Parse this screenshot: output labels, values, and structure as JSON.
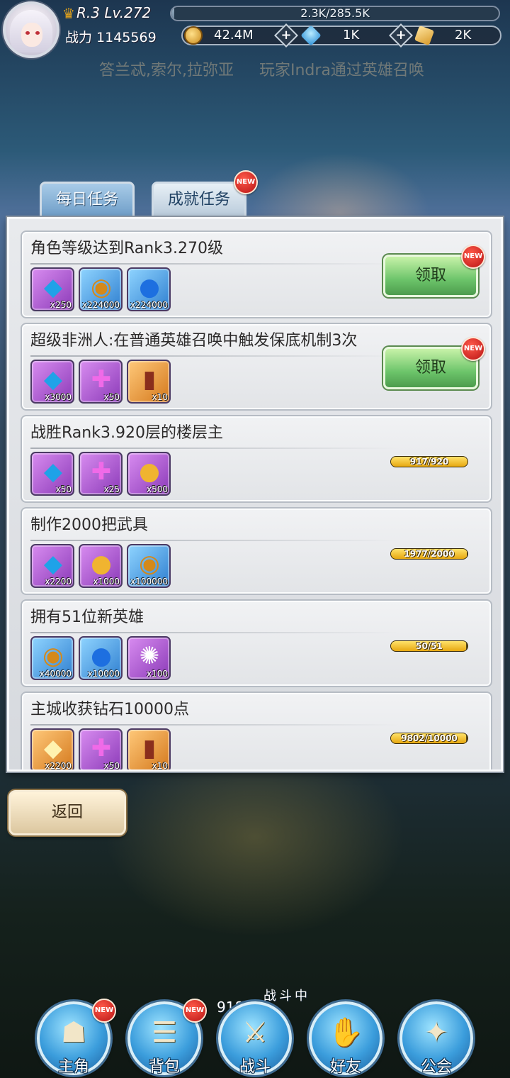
{
  "player": {
    "rank_level": "R.3 Lv.272",
    "exp_text": "2.3K/285.5K",
    "exp_fraction": 0.008,
    "power_label": "战力 1145569"
  },
  "currencies": [
    {
      "icon": "gold-coin-icon",
      "value": "42.4M"
    },
    {
      "icon": "diamond-icon",
      "value": "1K"
    },
    {
      "icon": "crystal-icon",
      "value": "2K"
    }
  ],
  "ticker": [
    "答兰忒,索尔,拉弥亚",
    "玩家Indra通过英雄召唤"
  ],
  "tabs": [
    {
      "label": "每日任务",
      "active": false
    },
    {
      "label": "成就任务",
      "active": true,
      "badge": "NEW"
    }
  ],
  "tasks": [
    {
      "title": "角色等级达到Rank3.270级",
      "rewards": [
        {
          "icon": "diamond-icon",
          "glyph": "◆",
          "bg": "purple",
          "count": "x250"
        },
        {
          "icon": "gold-coin-icon",
          "glyph": "◉",
          "bg": "blue",
          "count": "x224000"
        },
        {
          "icon": "potion-icon",
          "glyph": "●",
          "bg": "blue",
          "count": "x224000"
        }
      ],
      "action": "claim",
      "action_label": "领取",
      "badge": "NEW"
    },
    {
      "title": "超级非洲人:在普通英雄召唤中触发保底机制3次",
      "rewards": [
        {
          "icon": "diamond-icon",
          "glyph": "◆",
          "bg": "purple",
          "count": "x3000"
        },
        {
          "icon": "puzzle-icon",
          "glyph": "✚",
          "bg": "purple",
          "count": "x50"
        },
        {
          "icon": "summon-card-icon",
          "glyph": "▮",
          "bg": "orange",
          "count": "x10"
        }
      ],
      "action": "claim",
      "action_label": "领取",
      "badge": "NEW"
    },
    {
      "title": "战胜Rank3.920层的楼层主",
      "rewards": [
        {
          "icon": "diamond-icon",
          "glyph": "◆",
          "bg": "purple",
          "count": "x50"
        },
        {
          "icon": "puzzle-icon",
          "glyph": "✚",
          "bg": "purple",
          "count": "x25"
        },
        {
          "icon": "treasure-bag-icon",
          "glyph": "●",
          "bg": "purple",
          "count": "x500"
        }
      ],
      "action": "progress",
      "progress_text": "917/920",
      "progress": 0.997
    },
    {
      "title": "制作2000把武具",
      "rewards": [
        {
          "icon": "diamond-icon",
          "glyph": "◆",
          "bg": "purple",
          "count": "x2200"
        },
        {
          "icon": "treasure-bag-icon",
          "glyph": "●",
          "bg": "purple",
          "count": "x1000"
        },
        {
          "icon": "gold-coin-icon",
          "glyph": "◉",
          "bg": "blue",
          "count": "x100000"
        }
      ],
      "action": "progress",
      "progress_text": "1977/2000",
      "progress": 0.989
    },
    {
      "title": "拥有51位新英雄",
      "rewards": [
        {
          "icon": "gold-coin-icon",
          "glyph": "◉",
          "bg": "blue",
          "count": "x40000"
        },
        {
          "icon": "potion-icon",
          "glyph": "●",
          "bg": "blue",
          "count": "x10000"
        },
        {
          "icon": "rainbow-orb-icon",
          "glyph": "✺",
          "bg": "purple",
          "count": "x100"
        }
      ],
      "action": "progress",
      "progress_text": "50/51",
      "progress": 0.98
    },
    {
      "title": "主城收获钻石10000点",
      "rewards": [
        {
          "icon": "crystal-icon",
          "glyph": "◆",
          "bg": "orange",
          "count": "x2200"
        },
        {
          "icon": "puzzle-icon",
          "glyph": "✚",
          "bg": "purple",
          "count": "x50"
        },
        {
          "icon": "summon-card-icon",
          "glyph": "▮",
          "bg": "orange",
          "count": "x10"
        }
      ],
      "action": "progress",
      "progress_text": "9802/10000",
      "progress": 0.98
    }
  ],
  "back_label": "返回",
  "battle": {
    "floor": "918层",
    "status": "战斗中"
  },
  "nav": [
    {
      "name": "nav-hero",
      "icon": "helmet-icon",
      "glyph": "☗",
      "label": "主角",
      "badge": "NEW"
    },
    {
      "name": "nav-bag",
      "icon": "backpack-icon",
      "glyph": "☰",
      "label": "背包",
      "badge": "NEW"
    },
    {
      "name": "nav-battle",
      "icon": "crossed-swords-icon",
      "glyph": "⚔",
      "label": "战斗"
    },
    {
      "name": "nav-friends",
      "icon": "handshake-icon",
      "glyph": "✋",
      "label": "好友"
    },
    {
      "name": "nav-guild",
      "icon": "guild-emblem-icon",
      "glyph": "✦",
      "label": "公会"
    }
  ],
  "colors": {
    "accent_blue": "#3b9ddc",
    "claim_green": "#6cc46a",
    "progress_gold": "#e7a810",
    "badge_red": "#d81c1c"
  }
}
